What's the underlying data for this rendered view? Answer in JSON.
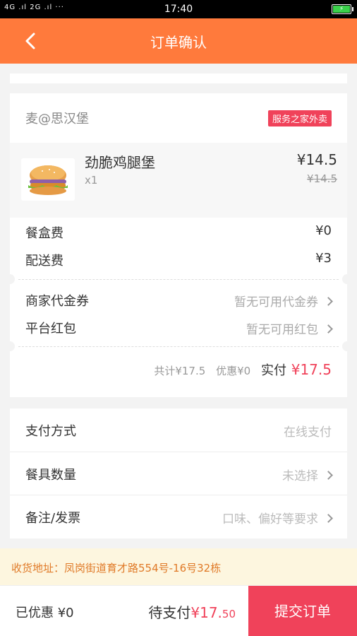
{
  "status_bar": {
    "signals": "4G .ıl 2G .ıl  ···",
    "time": "17:40",
    "battery_icon": "battery-charging-icon"
  },
  "header": {
    "title": "订单确认",
    "back_icon": "chevron-left-icon",
    "color": "#ff7a3c"
  },
  "shop": {
    "name": "麦@思汉堡",
    "badge": "服务之家外卖",
    "badge_color": "#f0425a"
  },
  "item": {
    "name": "劲脆鸡腿堡",
    "qty": "x1",
    "price": "¥14.5",
    "original_price": "¥14.5",
    "image_icon": "burger-image"
  },
  "fees": [
    {
      "label": "餐盒费",
      "value": "¥0"
    },
    {
      "label": "配送费",
      "value": "¥3"
    }
  ],
  "discounts": [
    {
      "label": "商家代金券",
      "value": "暂无可用代金券"
    },
    {
      "label": "平台红包",
      "value": "暂无可用红包"
    }
  ],
  "summary": {
    "total": "共计¥17.5",
    "discount": "优惠¥0",
    "pay_label": "实付",
    "pay_value": "¥17.5"
  },
  "options": [
    {
      "label": "支付方式",
      "value": "在线支付"
    },
    {
      "label": "餐具数量",
      "value": "未选择"
    },
    {
      "label": "备注/发票",
      "value": "口味、偏好等要求"
    }
  ],
  "address": {
    "text": "收货地址：凤岗街道育才路554号-16号32栋"
  },
  "bottom": {
    "discounted": "已优惠 ¥0",
    "to_pay_label": "待支付",
    "to_pay_main": "¥17.",
    "to_pay_small": "50",
    "submit": "提交订单",
    "accent": "#f0425a"
  }
}
